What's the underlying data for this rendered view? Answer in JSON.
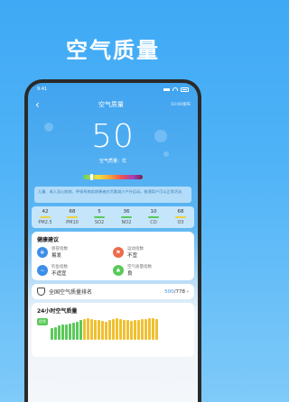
{
  "promo": {
    "title": "空气质量"
  },
  "status_bar": {
    "time": "9:41"
  },
  "nav": {
    "back_label": "‹",
    "title": "空气质量",
    "update_time": "10:00发布"
  },
  "aqi": {
    "value": "50",
    "label": "空气质量：优"
  },
  "description": "儿童、老人及心脏病、呼吸系统疾病患者应尽量减少户外运动，普通用户可以正常活动",
  "pollutants": [
    {
      "value": "42",
      "name": "PM2.5",
      "color": "#f0d040"
    },
    {
      "value": "68",
      "name": "PM10",
      "color": "#f0d040"
    },
    {
      "value": "5",
      "name": "SO2",
      "color": "#5ac95a"
    },
    {
      "value": "36",
      "name": "NO2",
      "color": "#5ac95a"
    },
    {
      "value": "10",
      "name": "CO",
      "color": "#5ac95a"
    },
    {
      "value": "68",
      "name": "O3",
      "color": "#f0d040"
    }
  ],
  "health": {
    "title": "健康建议",
    "items": [
      {
        "name": "感冒指数",
        "value": "易发",
        "color": "#3d8ee8",
        "icon": "cold-icon"
      },
      {
        "name": "运动指数",
        "value": "不宜",
        "color": "#ee6a4a",
        "icon": "sport-icon"
      },
      {
        "name": "钓鱼指数",
        "value": "不适宜",
        "color": "#3d8ee8",
        "icon": "fishing-icon"
      },
      {
        "name": "空气质量指数",
        "value": "良",
        "color": "#5ac95a",
        "icon": "leaf-icon"
      }
    ]
  },
  "ranking": {
    "label": "全国空气质量排名",
    "position": "500",
    "total": "/778",
    "arrow": "›"
  },
  "hourly": {
    "title": "24小时空气质量",
    "badge": "优秀",
    "bar_levels": [
      0.55,
      0.6,
      0.65,
      0.7,
      0.72,
      0.75,
      0.8,
      0.85,
      0.9,
      0.95,
      1,
      0.95,
      0.9,
      0.92,
      0.88,
      0.85,
      0.9,
      0.95,
      1,
      0.97,
      0.93,
      0.9,
      0.88,
      0.9,
      0.92,
      0.95,
      0.97,
      1,
      0.98,
      0.95
    ]
  }
}
